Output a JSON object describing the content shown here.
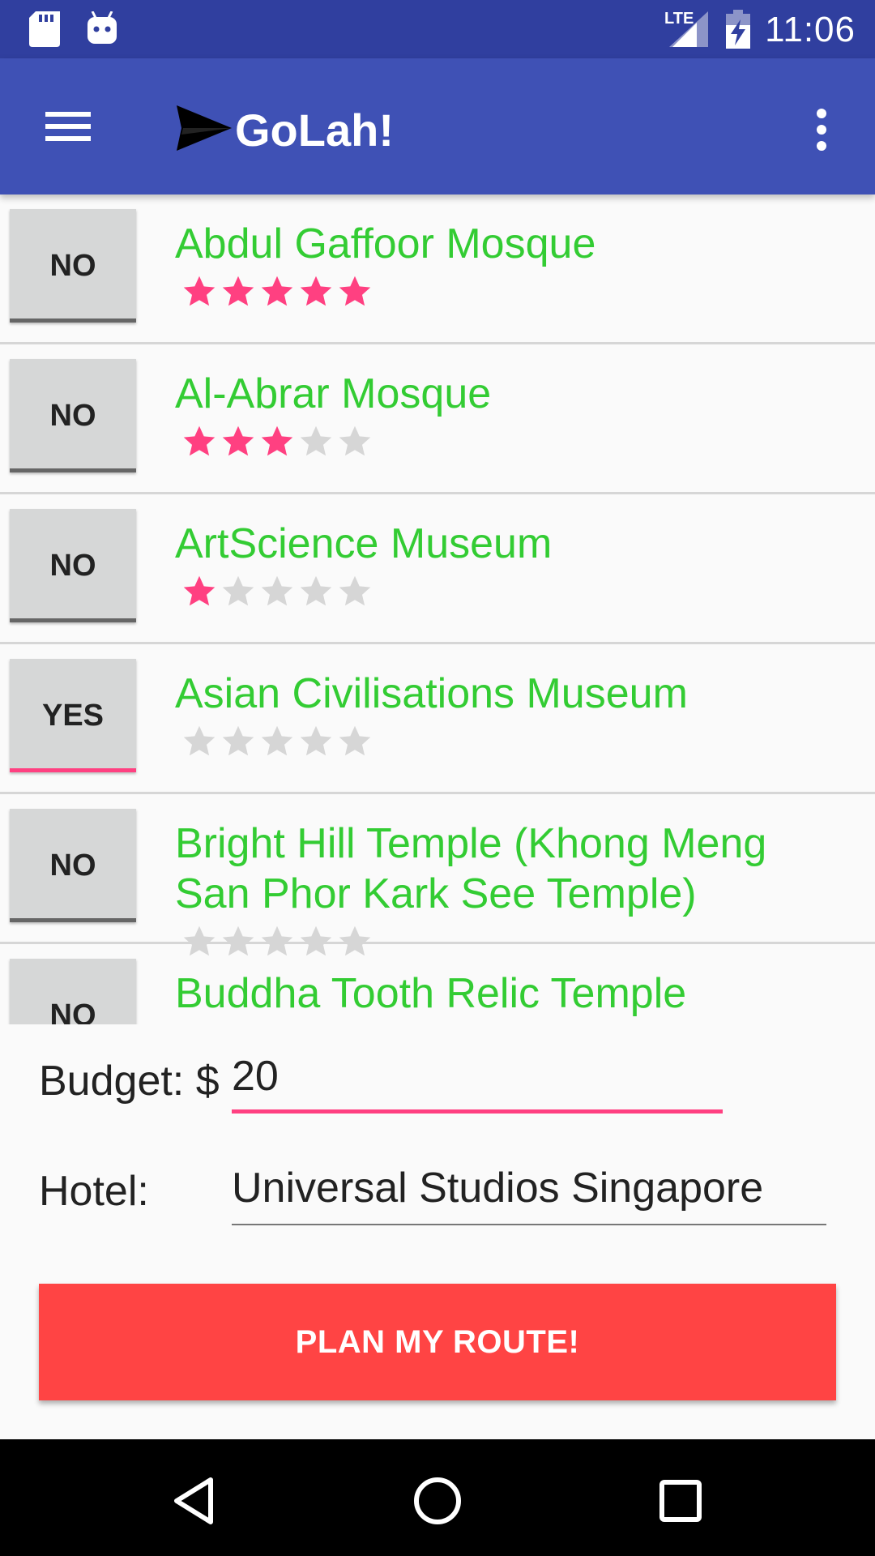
{
  "status_bar": {
    "time": "11:06",
    "network": "LTE",
    "left_icons": [
      "sd-card-icon",
      "android-icon"
    ],
    "right_icons": [
      "signal-icon",
      "battery-charging-icon"
    ]
  },
  "app_bar": {
    "title": "GoLah!",
    "color": "#3f51b5",
    "menu_icon": "hamburger-menu-icon",
    "logo_icon": "paper-plane-icon",
    "overflow_icon": "more-vert-icon"
  },
  "places": [
    {
      "name": "Abdul Gaffoor Mosque",
      "selected": "NO",
      "rating": 5,
      "max_rating": 5
    },
    {
      "name": "Al-Abrar Mosque",
      "selected": "NO",
      "rating": 3,
      "max_rating": 5
    },
    {
      "name": "ArtScience Museum",
      "selected": "NO",
      "rating": 1,
      "max_rating": 5
    },
    {
      "name": "Asian Civilisations Museum",
      "selected": "YES",
      "rating": 0,
      "max_rating": 5
    },
    {
      "name": "Bright Hill Temple (Khong Meng San Phor Kark See Temple)",
      "selected": "NO",
      "rating": 0,
      "max_rating": 5
    },
    {
      "name": "Buddha Tooth Relic Temple",
      "selected": "NO",
      "rating": 0,
      "max_rating": 5
    }
  ],
  "form": {
    "budget_label": "Budget: $",
    "budget_value": "20",
    "hotel_label": "Hotel:",
    "hotel_value": "Universal Studios Singapore"
  },
  "plan_button": {
    "label": "PLAN MY ROUTE!",
    "color": "#ff4444"
  },
  "colors": {
    "accent": "#ff4081",
    "place_name": "#33cc33",
    "star_filled": "#ff4081",
    "star_empty": "#d6d6d6"
  },
  "nav_bar": {
    "icons": [
      "back-icon",
      "home-icon",
      "recents-icon"
    ]
  }
}
